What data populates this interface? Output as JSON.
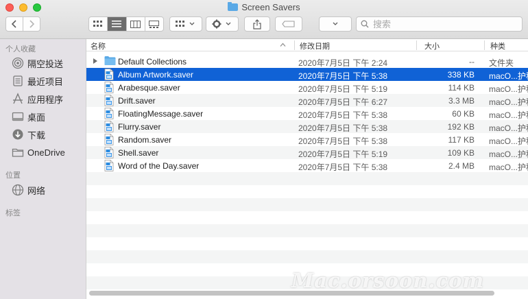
{
  "window": {
    "title": "Screen Savers"
  },
  "toolbar": {
    "back_icon": "chevron-left-icon",
    "forward_icon": "chevron-right-icon",
    "view_modes": [
      "icon",
      "list",
      "column",
      "gallery"
    ],
    "active_view": "list",
    "search_placeholder": "搜索"
  },
  "sidebar": {
    "sections": [
      {
        "heading": "个人收藏",
        "items": [
          {
            "label": "隔空投送",
            "icon": "airdrop-icon"
          },
          {
            "label": "最近项目",
            "icon": "recents-icon"
          },
          {
            "label": "应用程序",
            "icon": "applications-icon"
          },
          {
            "label": "桌面",
            "icon": "desktop-icon"
          },
          {
            "label": "下载",
            "icon": "downloads-icon"
          },
          {
            "label": "OneDrive",
            "icon": "folder-icon"
          }
        ]
      },
      {
        "heading": "位置",
        "items": [
          {
            "label": "网络",
            "icon": "network-icon"
          }
        ]
      },
      {
        "heading": "标签",
        "items": []
      }
    ]
  },
  "list": {
    "columns": {
      "name": "名称",
      "date": "修改日期",
      "size": "大小",
      "kind": "种类"
    },
    "rows": [
      {
        "name": "Default Collections",
        "date": "2020年7月5日 下午 2:24",
        "size": "--",
        "kind": "文件夹",
        "type": "folder",
        "selected": false
      },
      {
        "name": "Album Artwork.saver",
        "date": "2020年7月5日 下午 5:38",
        "size": "338 KB",
        "kind": "macO...护程序",
        "type": "saver",
        "selected": true
      },
      {
        "name": "Arabesque.saver",
        "date": "2020年7月5日 下午 5:19",
        "size": "114 KB",
        "kind": "macO...护程序",
        "type": "saver",
        "selected": false
      },
      {
        "name": "Drift.saver",
        "date": "2020年7月5日 下午 6:27",
        "size": "3.3 MB",
        "kind": "macO...护程序",
        "type": "saver",
        "selected": false
      },
      {
        "name": "FloatingMessage.saver",
        "date": "2020年7月5日 下午 5:38",
        "size": "60 KB",
        "kind": "macO...护程序",
        "type": "saver",
        "selected": false
      },
      {
        "name": "Flurry.saver",
        "date": "2020年7月5日 下午 5:38",
        "size": "192 KB",
        "kind": "macO...护程序",
        "type": "saver",
        "selected": false
      },
      {
        "name": "Random.saver",
        "date": "2020年7月5日 下午 5:38",
        "size": "117 KB",
        "kind": "macO...护程序",
        "type": "saver",
        "selected": false
      },
      {
        "name": "Shell.saver",
        "date": "2020年7月5日 下午 5:19",
        "size": "109 KB",
        "kind": "macO...护程序",
        "type": "saver",
        "selected": false
      },
      {
        "name": "Word of the Day.saver",
        "date": "2020年7月5日 下午 5:38",
        "size": "2.4 MB",
        "kind": "macO...护程序",
        "type": "saver",
        "selected": false
      }
    ]
  },
  "watermark": "Mac.orsoon.com",
  "colors": {
    "selection": "#1062d6",
    "sidebar_bg": "#e4e1e6",
    "folder_blue": "#5aa9e6"
  }
}
